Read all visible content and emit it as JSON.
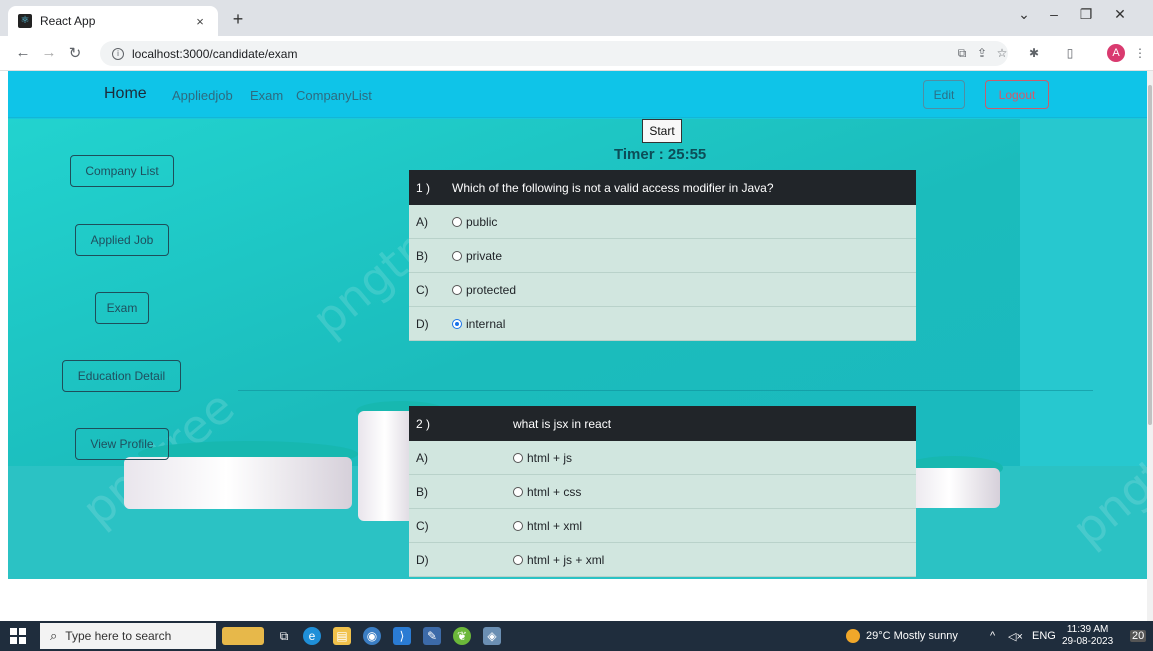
{
  "browser": {
    "tab_title": "React App",
    "tab_close": "×",
    "new_tab": "+",
    "url": "localhost:3000/candidate/exam",
    "profile_initial": "A",
    "window_minimize": "–",
    "window_restore": "❐",
    "window_close": "✕",
    "tab_dropdown": "⌄"
  },
  "navbar": {
    "home": "Home",
    "links": [
      "Appliedjob",
      "Exam",
      "CompanyList"
    ],
    "edit": "Edit",
    "logout": "Logout"
  },
  "sidebar": {
    "buttons": [
      "Company List",
      "Applied Job",
      "Exam",
      "Education Detail",
      "View Profile"
    ]
  },
  "exam": {
    "start_label": "Start",
    "timer": "Timer : 25:55",
    "questions": [
      {
        "number": "1 )",
        "text": "Which of the following is not a valid access modifier in Java?",
        "options": [
          {
            "letter": "A)",
            "text": "public",
            "checked": false
          },
          {
            "letter": "B)",
            "text": "private",
            "checked": false
          },
          {
            "letter": "C)",
            "text": "protected",
            "checked": false
          },
          {
            "letter": "D)",
            "text": "internal",
            "checked": true
          }
        ]
      },
      {
        "number": "2 )",
        "text": "what is jsx in react",
        "options": [
          {
            "letter": "A)",
            "text": "html + js",
            "checked": false
          },
          {
            "letter": "B)",
            "text": "html + css",
            "checked": false
          },
          {
            "letter": "C)",
            "text": "html + xml",
            "checked": false
          },
          {
            "letter": "D)",
            "text": "html + js + xml",
            "checked": false
          }
        ]
      }
    ]
  },
  "taskbar": {
    "search_placeholder": "Type here to search",
    "weather": "29°C  Mostly sunny",
    "language": "ENG",
    "time": "11:39 AM",
    "date": "29-08-2023",
    "notifications": "20"
  }
}
